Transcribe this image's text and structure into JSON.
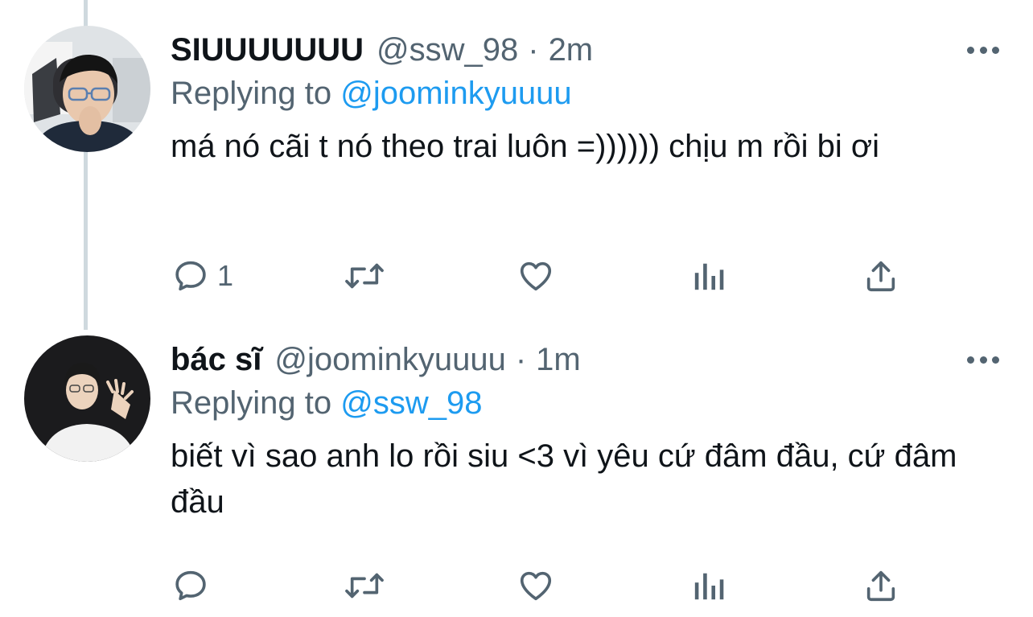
{
  "tweets": [
    {
      "display_name": "SIUUUUUUU",
      "handle": "@ssw_98",
      "separator": "·",
      "time": "2m",
      "replying_prefix": "Replying to",
      "replying_to": "@joominkyuuuu",
      "text": "má nó cãi t nó theo trai luôn =)))))) chịu m rồi bi ơi",
      "reply_count": "1",
      "avatar_icon": "profile-photo-man-glasses-hand-on-chin"
    },
    {
      "display_name": "bác sĩ",
      "handle": "@joominkyuuuu",
      "separator": "·",
      "time": "1m",
      "replying_prefix": "Replying to",
      "replying_to": "@ssw_98",
      "text": "biết vì sao anh lo rồi siu <3 vì yêu cứ đâm đầu, cứ đâm đầu",
      "reply_count": "",
      "avatar_icon": "profile-photo-man-glasses-waving"
    }
  ],
  "icons": {
    "reply": "speech-bubble-icon",
    "retweet": "retweet-arrows-icon",
    "like": "heart-icon",
    "analytics": "bar-chart-icon",
    "share": "share-upload-icon",
    "more": "ellipsis-icon"
  },
  "colors": {
    "text": "#0f1419",
    "secondary": "#536471",
    "link": "#1d9bf0",
    "thread_line": "#cfd9de"
  }
}
